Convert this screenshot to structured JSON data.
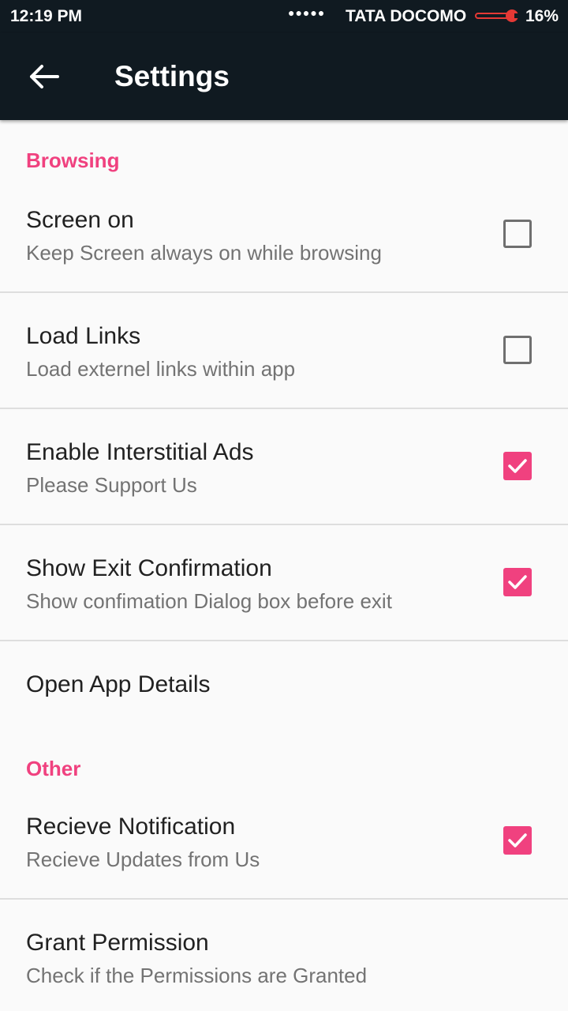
{
  "status_bar": {
    "time": "12:19 PM",
    "signal": "●●●●●",
    "carrier": "TATA DOCOMO",
    "battery": "16%"
  },
  "toolbar": {
    "title": "Settings",
    "back_icon": "arrow-left-icon"
  },
  "sections": {
    "browsing": "Browsing",
    "other": "Other"
  },
  "prefs": {
    "screen_on": {
      "title": "Screen on",
      "summary": "Keep Screen always on while browsing",
      "checked": false
    },
    "load_links": {
      "title": "Load Links",
      "summary": "Load externel links within app",
      "checked": false
    },
    "interstitial": {
      "title": "Enable Interstitial Ads",
      "summary": "Please Support Us",
      "checked": true
    },
    "exit_confirm": {
      "title": "Show Exit Confirmation",
      "summary": "Show confimation Dialog box before exit",
      "checked": true
    },
    "app_details": {
      "title": "Open App Details"
    },
    "notification": {
      "title": "Recieve Notification",
      "summary": "Recieve Updates from Us",
      "checked": true
    },
    "permission": {
      "title": "Grant Permission",
      "summary": "Check if the Permissions are Granted"
    }
  },
  "colors": {
    "accent": "#f0417f",
    "toolbar": "#101a21"
  }
}
